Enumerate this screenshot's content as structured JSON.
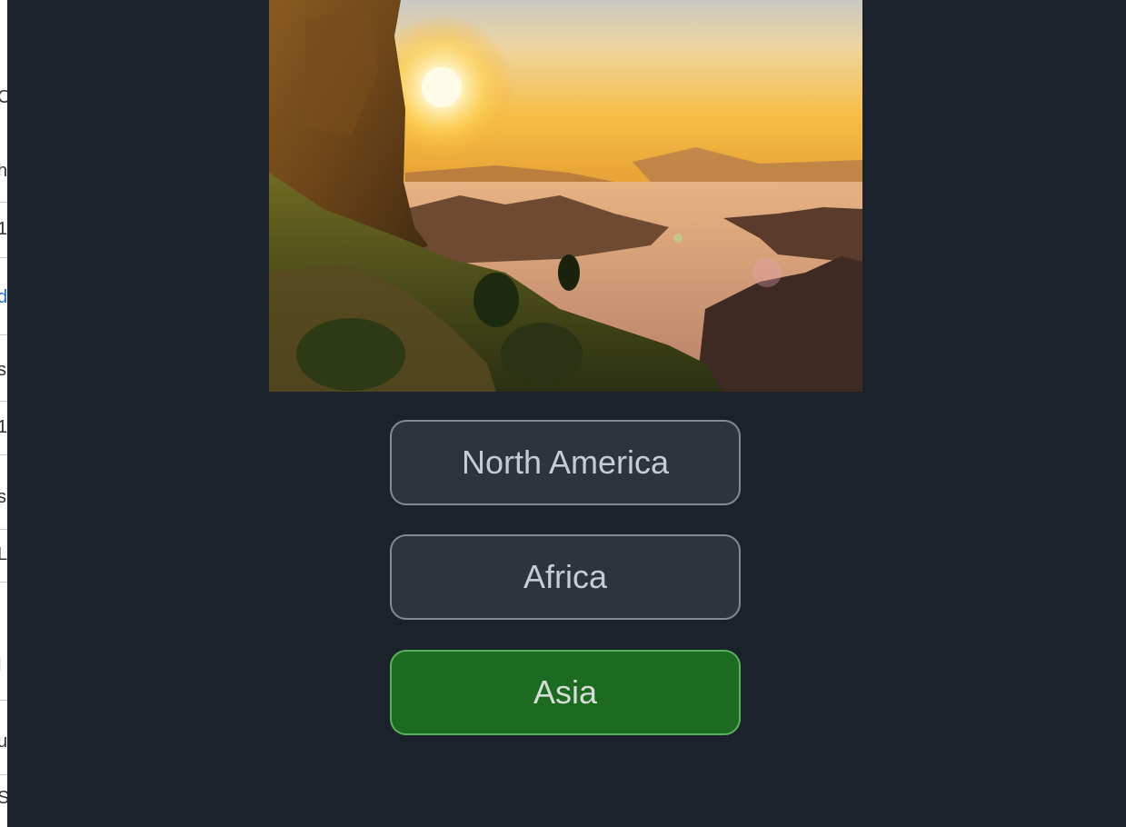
{
  "quiz": {
    "image_alt": "Sunrise over misty mountains from a grassy cliff",
    "answers": [
      {
        "label": "North America",
        "state": "default"
      },
      {
        "label": "Africa",
        "state": "default"
      },
      {
        "label": "Asia",
        "state": "correct"
      }
    ]
  },
  "background_page": {
    "edge_glyphs": [
      "C",
      "h",
      "1",
      "d",
      "s",
      "1",
      "s",
      "L",
      "l",
      "u",
      "S"
    ]
  },
  "colors": {
    "overlay_bg": "#1b222c",
    "button_bg": "#2e343e",
    "button_border": "#858a92",
    "correct_bg": "#1c6b21",
    "correct_border": "#57b35b",
    "link_blue": "#1a6fd1"
  }
}
